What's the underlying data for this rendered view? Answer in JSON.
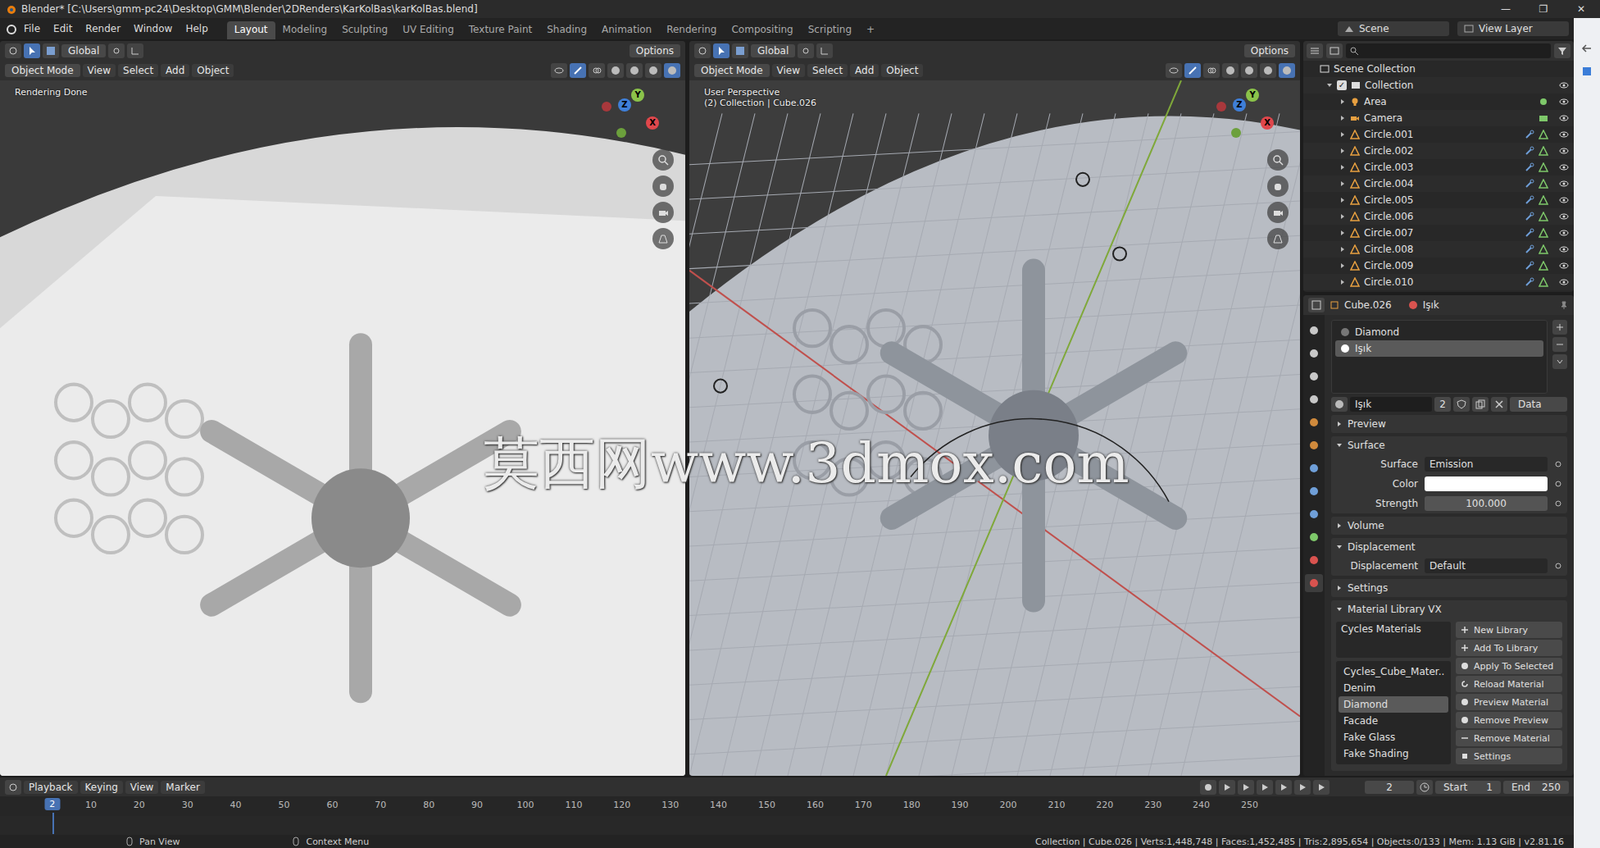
{
  "window": {
    "title": "Blender* [C:\\Users\\gmm-pc24\\Desktop\\GMM\\Blender\\2DRenders\\KarKolBas\\karKolBas.blend]",
    "controls": [
      "—",
      "❐",
      "✕"
    ]
  },
  "menu": [
    "File",
    "Edit",
    "Render",
    "Window",
    "Help"
  ],
  "workspaces": [
    {
      "label": "Layout",
      "selected": true
    },
    {
      "label": "Modeling",
      "selected": false
    },
    {
      "label": "Sculpting",
      "selected": false
    },
    {
      "label": "UV Editing",
      "selected": false
    },
    {
      "label": "Texture Paint",
      "selected": false
    },
    {
      "label": "Shading",
      "selected": false
    },
    {
      "label": "Animation",
      "selected": false
    },
    {
      "label": "Rendering",
      "selected": false
    },
    {
      "label": "Compositing",
      "selected": false
    },
    {
      "label": "Scripting",
      "selected": false
    }
  ],
  "add_workspace": "+",
  "scene": "Scene",
  "view_layer": "View Layer",
  "viewports": [
    {
      "kind": "render",
      "mode": "Object Mode",
      "menus": [
        "View",
        "Select",
        "Add",
        "Object"
      ],
      "orientation": "Global",
      "options": "Options",
      "overlay_lines": [
        "Rendering Done"
      ]
    },
    {
      "kind": "scene",
      "mode": "Object Mode",
      "menus": [
        "View",
        "Select",
        "Add",
        "Object"
      ],
      "orientation": "Global",
      "options": "Options",
      "overlay_lines": [
        "User Perspective",
        "(2) Collection | Cube.026"
      ]
    }
  ],
  "gizmo_axes": [
    "Y",
    "Z",
    "X"
  ],
  "watermark": "莫西网www.3dmox.com",
  "outliner": {
    "root": "Scene Collection",
    "items": [
      {
        "name": "Collection",
        "kind": "collection",
        "expanded": true
      },
      {
        "name": "Area",
        "kind": "light",
        "expanded": false
      },
      {
        "name": "Camera",
        "kind": "camera",
        "expanded": false
      },
      {
        "name": "Circle.001",
        "kind": "mesh",
        "expanded": false
      },
      {
        "name": "Circle.002",
        "kind": "mesh",
        "expanded": false
      },
      {
        "name": "Circle.003",
        "kind": "mesh",
        "expanded": false
      },
      {
        "name": "Circle.004",
        "kind": "mesh",
        "expanded": false
      },
      {
        "name": "Circle.005",
        "kind": "mesh",
        "expanded": false
      },
      {
        "name": "Circle.006",
        "kind": "mesh",
        "expanded": false
      },
      {
        "name": "Circle.007",
        "kind": "mesh",
        "expanded": false
      },
      {
        "name": "Circle.008",
        "kind": "mesh",
        "expanded": false
      },
      {
        "name": "Circle.009",
        "kind": "mesh",
        "expanded": false
      },
      {
        "name": "Circle.010",
        "kind": "mesh",
        "expanded": false
      }
    ]
  },
  "properties": {
    "object": "Cube.026",
    "material": "Işık",
    "slots": [
      {
        "name": "Diamond",
        "selected": false
      },
      {
        "name": "Işık",
        "selected": true
      }
    ],
    "material_name": "Işık",
    "users": "2",
    "link": "Data",
    "panels": [
      {
        "title": "Preview",
        "expanded": false,
        "fields": []
      },
      {
        "title": "Surface",
        "expanded": true,
        "fields": [
          {
            "label": "Surface",
            "value": "Emission",
            "kind": "dropdown",
            "color": ""
          },
          {
            "label": "Color",
            "value": "",
            "kind": "color",
            "color": "#ffffff"
          },
          {
            "label": "Strength",
            "value": "100.000",
            "kind": "number",
            "color": ""
          }
        ]
      },
      {
        "title": "Volume",
        "expanded": false,
        "fields": []
      },
      {
        "title": "Displacement",
        "expanded": true,
        "fields": [
          {
            "label": "Displacement",
            "value": "Default",
            "kind": "dropdown",
            "color": ""
          }
        ]
      },
      {
        "title": "Settings",
        "expanded": false,
        "fields": []
      }
    ],
    "library": {
      "title": "Material Library VX",
      "expanded": true,
      "source": "Cycles Materials",
      "materials": [
        {
          "name": "Cycles_Cube_Mater..",
          "selected": false
        },
        {
          "name": "Denim",
          "selected": false
        },
        {
          "name": "Diamond",
          "selected": true
        },
        {
          "name": "Facade",
          "selected": false
        },
        {
          "name": "Fake Glass",
          "selected": false
        },
        {
          "name": "Fake Shading",
          "selected": false
        }
      ],
      "buttons": [
        {
          "label": "New Library",
          "kind": "add"
        },
        {
          "label": "Add To Library",
          "kind": "add"
        },
        {
          "label": "Apply To Selected",
          "kind": "apply"
        },
        {
          "label": "Reload Material",
          "kind": "reload"
        },
        {
          "label": "Preview Material",
          "kind": "preview"
        },
        {
          "label": "Remove Preview",
          "kind": "preview"
        },
        {
          "label": "Remove Material",
          "kind": "remove"
        },
        {
          "label": "Settings",
          "kind": "settings"
        }
      ]
    }
  },
  "timeline": {
    "menus": [
      "Playback",
      "Keying",
      "View",
      "Marker"
    ],
    "current": "2",
    "start_label": "Start",
    "start": "1",
    "end_label": "End",
    "end": "250",
    "ticks": [
      "10",
      "20",
      "30",
      "40",
      "50",
      "60",
      "70",
      "80",
      "90",
      "100",
      "110",
      "120",
      "130",
      "140",
      "150",
      "160",
      "170",
      "180",
      "190",
      "200",
      "210",
      "220",
      "230",
      "240",
      "250"
    ]
  },
  "status_bar": {
    "hints": [
      "Pan View",
      "Context Menu"
    ],
    "stats": "Collection | Cube.026 | Verts:1,448,748 | Faces:1,452,485 | Tris:2,895,654 | Objects:0/133 | Mem: 1.13 GiB | v2.81.16"
  }
}
